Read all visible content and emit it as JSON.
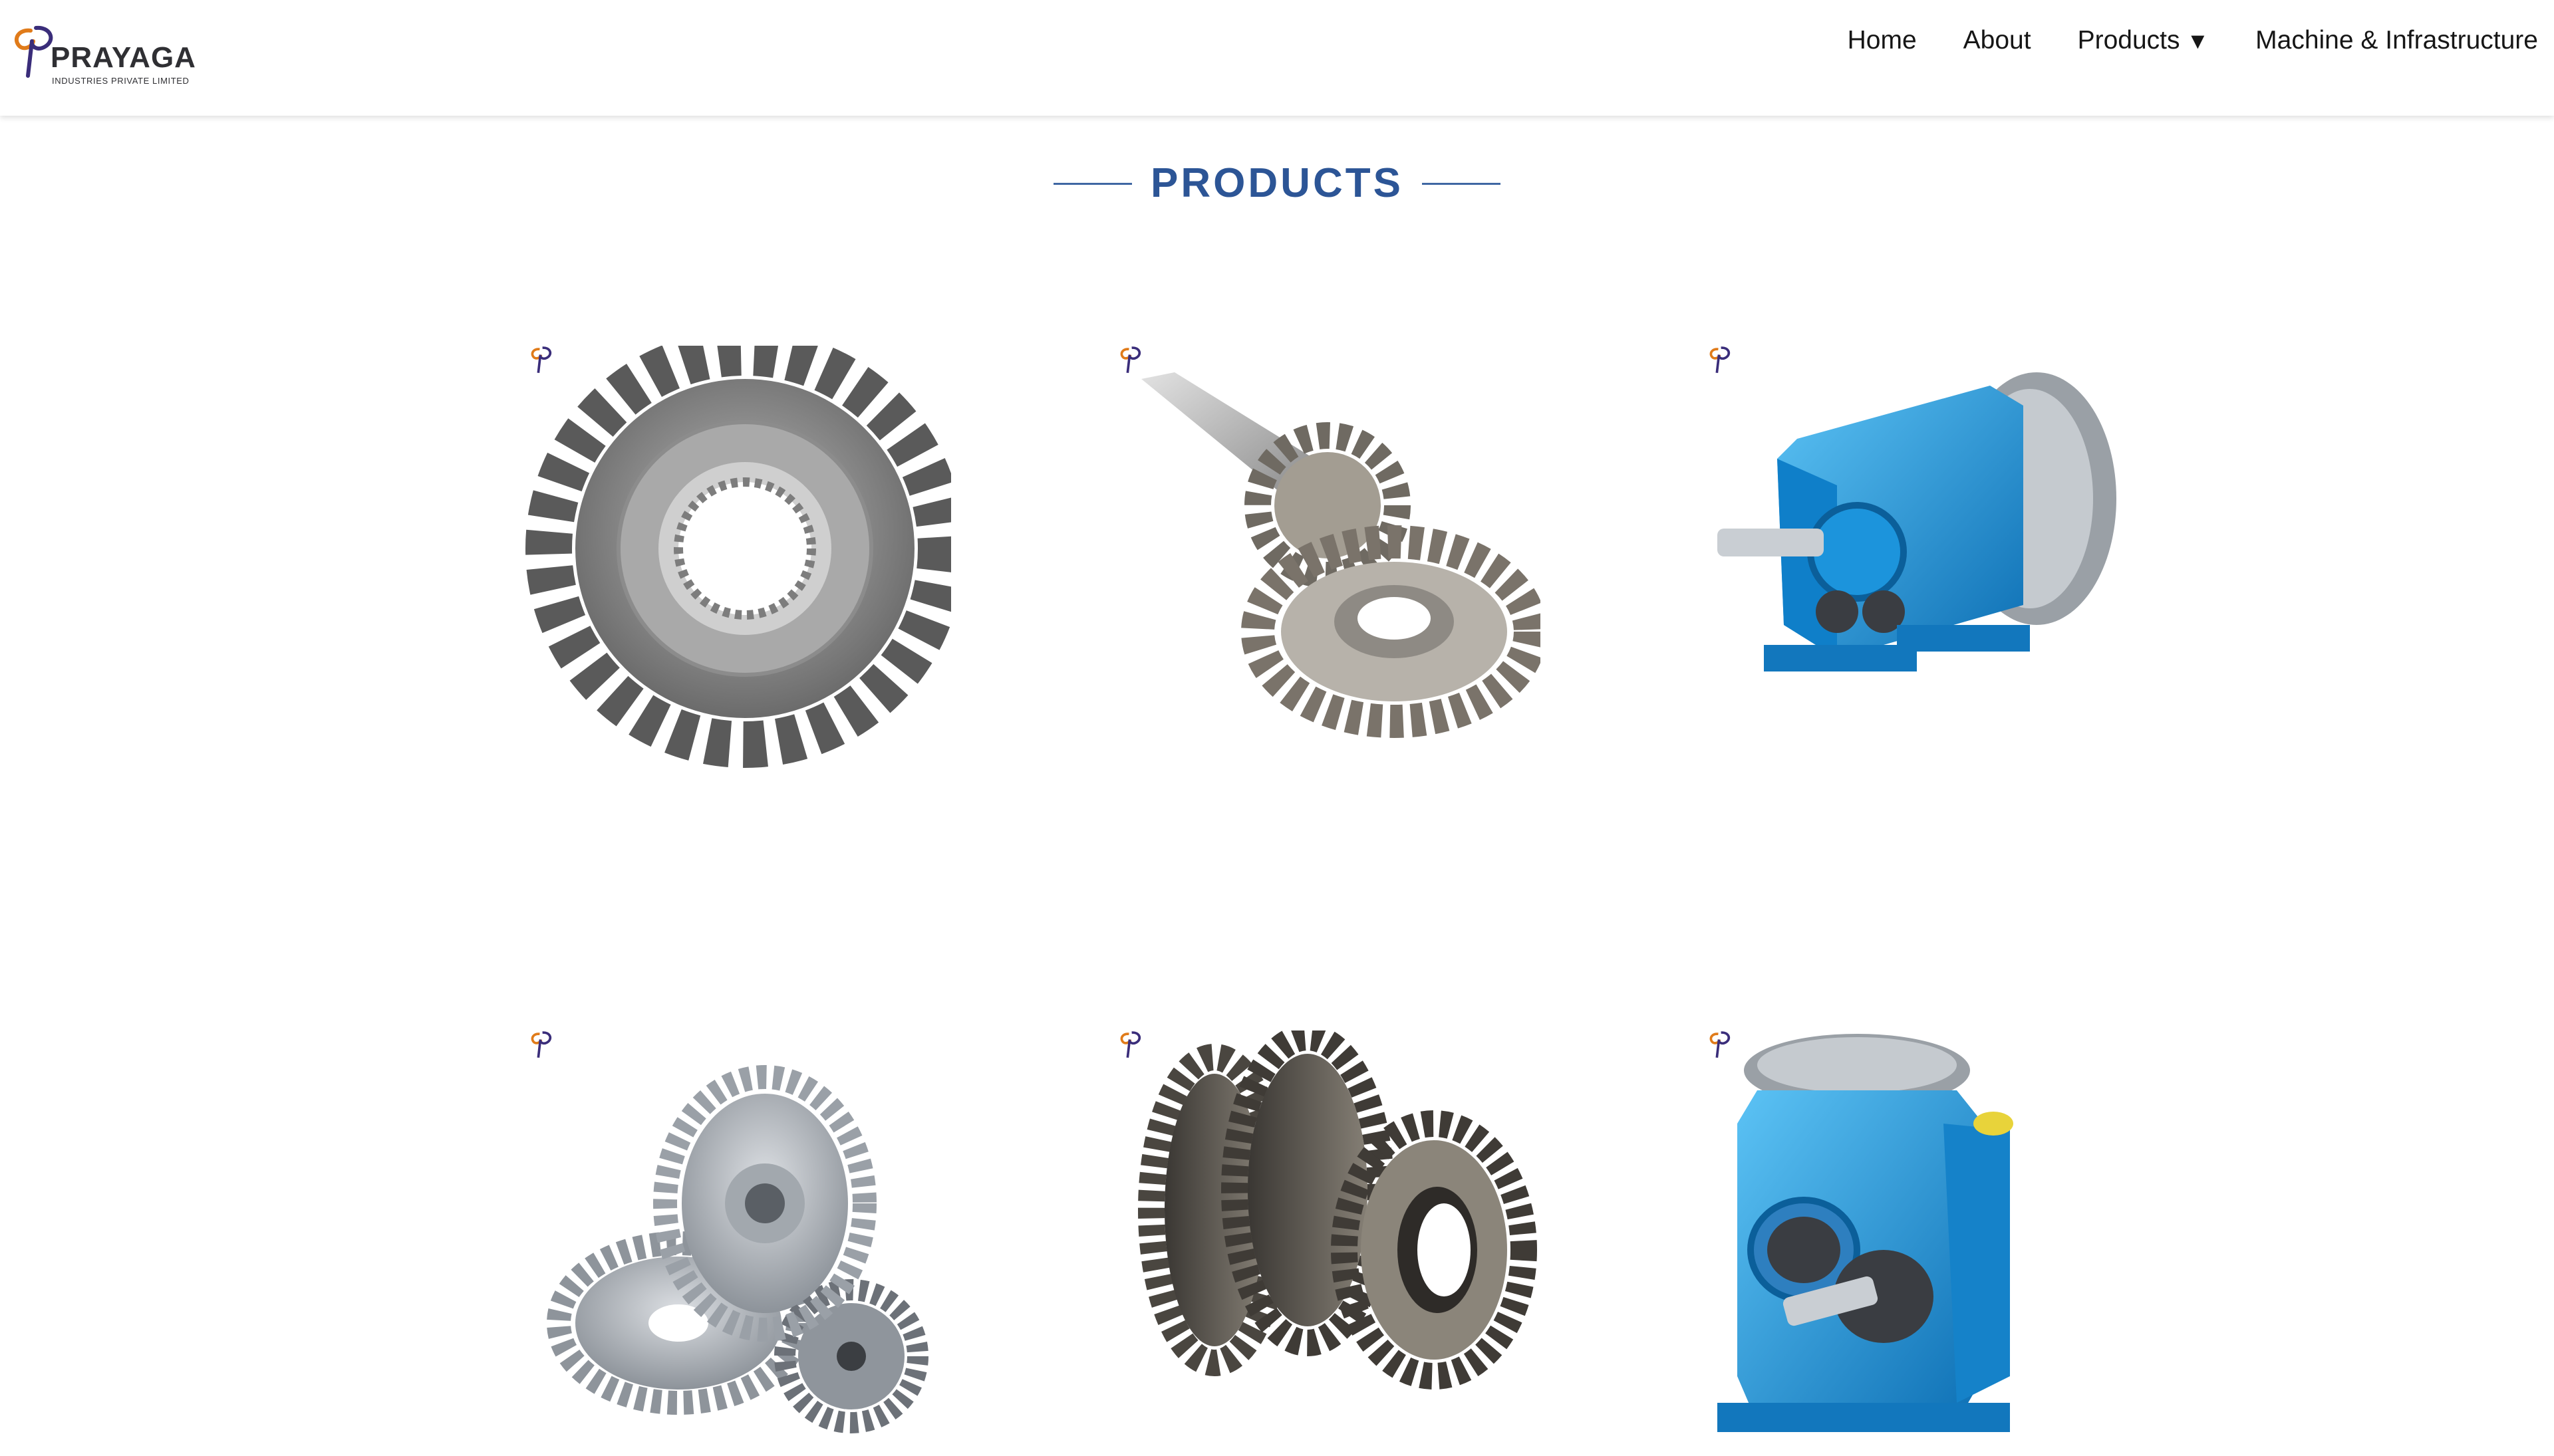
{
  "brand": {
    "name": "PRAYAGA",
    "tagline": "INDUSTRIES PRIVATE LIMITED"
  },
  "nav": {
    "items": [
      "Home",
      "About",
      "Products",
      "Machine & Infrastructure"
    ],
    "dropdown_caret": "▼"
  },
  "section": {
    "title": "PRODUCTS"
  },
  "products": [
    {
      "icon": "spiral-bevel-gear-icon"
    },
    {
      "icon": "bevel-gear-pinion-set-icon"
    },
    {
      "icon": "helical-gearbox-icon"
    },
    {
      "icon": "spur-gears-icon"
    },
    {
      "icon": "helical-gear-cluster-icon"
    },
    {
      "icon": "worm-gearbox-icon"
    }
  ],
  "colors": {
    "title_blue": "#2c5596",
    "title_line": "#3f67a3",
    "gearbox_blue": "#1b8fd6",
    "logo_orange": "#e07b1a",
    "logo_purple": "#3a2d7a"
  }
}
